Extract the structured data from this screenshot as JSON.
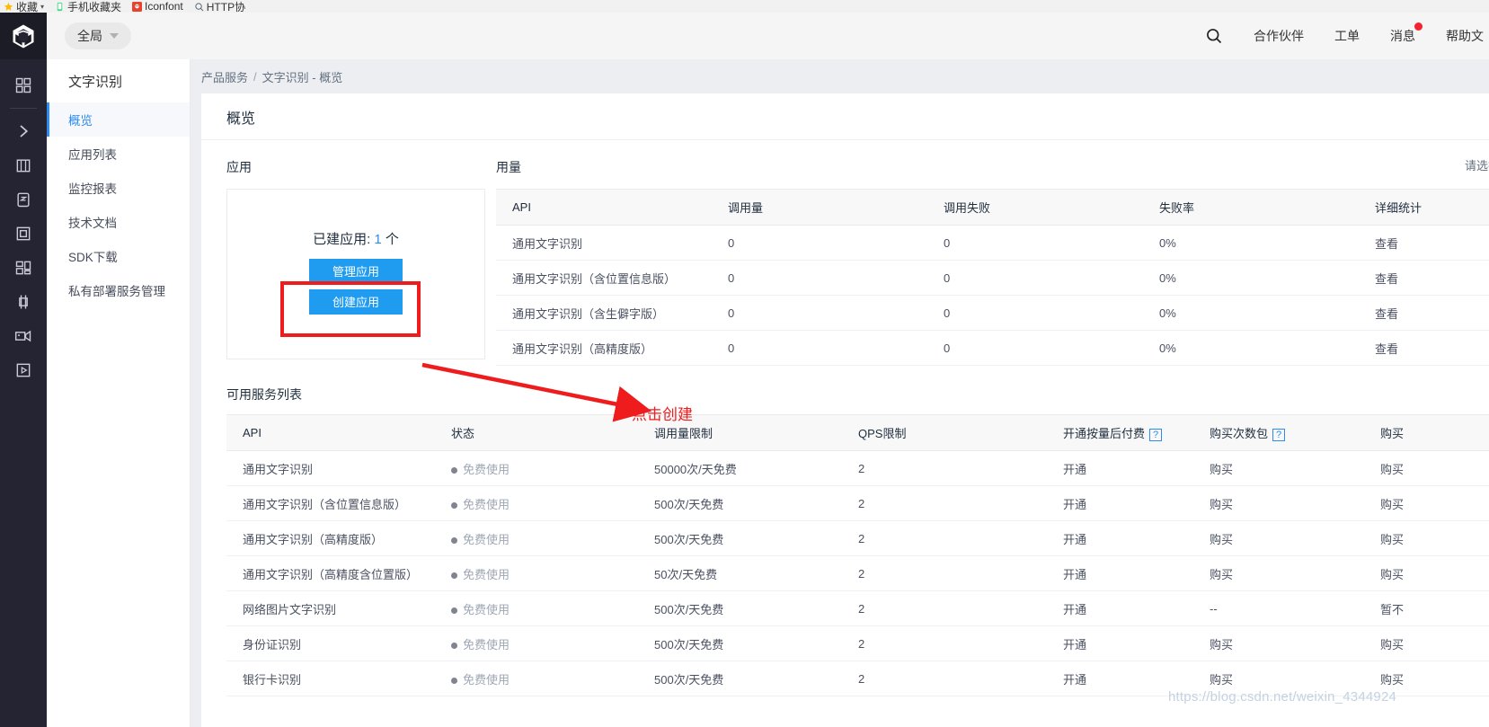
{
  "browser": {
    "bookmarks": [
      {
        "label": "收藏",
        "icon": "star-icon",
        "has_caret": true
      },
      {
        "label": "手机收藏夹",
        "icon": "mobile-icon",
        "has_caret": false
      },
      {
        "label": "Iconfont",
        "icon": "iconfont-icon",
        "has_caret": false
      },
      {
        "label": "HTTP协",
        "icon": "http-icon",
        "has_caret": false
      }
    ]
  },
  "header": {
    "logo": "cube-logo",
    "scope": {
      "label": "全局",
      "icon": "chevron-down-icon"
    },
    "search_icon": "search-icon",
    "items": [
      {
        "label": "合作伙伴",
        "badge": false
      },
      {
        "label": "工单",
        "badge": false
      },
      {
        "label": "消息",
        "badge": true
      },
      {
        "label": "帮助文",
        "badge": false
      }
    ]
  },
  "rail": {
    "items": [
      {
        "name": "apps-grid-icon"
      },
      {
        "name": "chevron-right-icon"
      },
      {
        "name": "building-icon"
      },
      {
        "name": "document-icon"
      },
      {
        "name": "frame-icon"
      },
      {
        "name": "dashboard-icon"
      },
      {
        "name": "network-icon"
      },
      {
        "name": "video-icon"
      },
      {
        "name": "play-icon"
      }
    ]
  },
  "sidebar": {
    "title": "文字识别",
    "items": [
      {
        "label": "概览",
        "active": true
      },
      {
        "label": "应用列表",
        "active": false
      },
      {
        "label": "监控报表",
        "active": false
      },
      {
        "label": "技术文档",
        "active": false
      },
      {
        "label": "SDK下载",
        "active": false
      },
      {
        "label": "私有部署服务管理",
        "active": false
      }
    ]
  },
  "breadcrumb": {
    "root": "产品服务",
    "separator": "/",
    "current": "文字识别 - 概览"
  },
  "panel": {
    "title": "概览"
  },
  "application": {
    "section_label": "应用",
    "count_prefix": "已建应用:",
    "count": "1",
    "count_suffix": "个",
    "manage_label": "管理应用",
    "create_label": "创建应用"
  },
  "usage": {
    "section_label": "用量",
    "select_label": "请选择",
    "columns": [
      "API",
      "调用量",
      "调用失败",
      "失败率",
      "详细统计"
    ],
    "rows": [
      {
        "api": "通用文字识别",
        "calls": "0",
        "fails": "0",
        "rate": "0%",
        "detail": "查看"
      },
      {
        "api": "通用文字识别（含位置信息版）",
        "calls": "0",
        "fails": "0",
        "rate": "0%",
        "detail": "查看"
      },
      {
        "api": "通用文字识别（含生僻字版）",
        "calls": "0",
        "fails": "0",
        "rate": "0%",
        "detail": "查看"
      },
      {
        "api": "通用文字识别（高精度版）",
        "calls": "0",
        "fails": "0",
        "rate": "0%",
        "detail": "查看"
      }
    ]
  },
  "services": {
    "section_label": "可用服务列表",
    "columns": [
      "API",
      "状态",
      "调用量限制",
      "QPS限制",
      "开通按量后付费",
      "购买次数包",
      "购买"
    ],
    "help_icon": "?",
    "rows": [
      {
        "api": "通用文字识别",
        "status": "免费使用",
        "limit": "50000次/天免费",
        "qps": "2",
        "pay": "开通",
        "pack": "购买",
        "buy": "购买"
      },
      {
        "api": "通用文字识别（含位置信息版）",
        "status": "免费使用",
        "limit": "500次/天免费",
        "qps": "2",
        "pay": "开通",
        "pack": "购买",
        "buy": "购买"
      },
      {
        "api": "通用文字识别（高精度版）",
        "status": "免费使用",
        "limit": "500次/天免费",
        "qps": "2",
        "pay": "开通",
        "pack": "购买",
        "buy": "购买"
      },
      {
        "api": "通用文字识别（高精度含位置版）",
        "status": "免费使用",
        "limit": "50次/天免费",
        "qps": "2",
        "pay": "开通",
        "pack": "购买",
        "buy": "购买"
      },
      {
        "api": "网络图片文字识别",
        "status": "免费使用",
        "limit": "500次/天免费",
        "qps": "2",
        "pay": "开通",
        "pack": "--",
        "buy": "暂不"
      },
      {
        "api": "身份证识别",
        "status": "免费使用",
        "limit": "500次/天免费",
        "qps": "2",
        "pay": "开通",
        "pack": "购买",
        "buy": "购买"
      },
      {
        "api": "银行卡识别",
        "status": "免费使用",
        "limit": "500次/天免费",
        "qps": "2",
        "pay": "开通",
        "pack": "购买",
        "buy": "购买"
      }
    ]
  },
  "annotation": {
    "arrow_label": "点击创建",
    "color": "#ee1c1c"
  },
  "watermark": {
    "text": "https://blog.csdn.net/weixin_4344924"
  }
}
